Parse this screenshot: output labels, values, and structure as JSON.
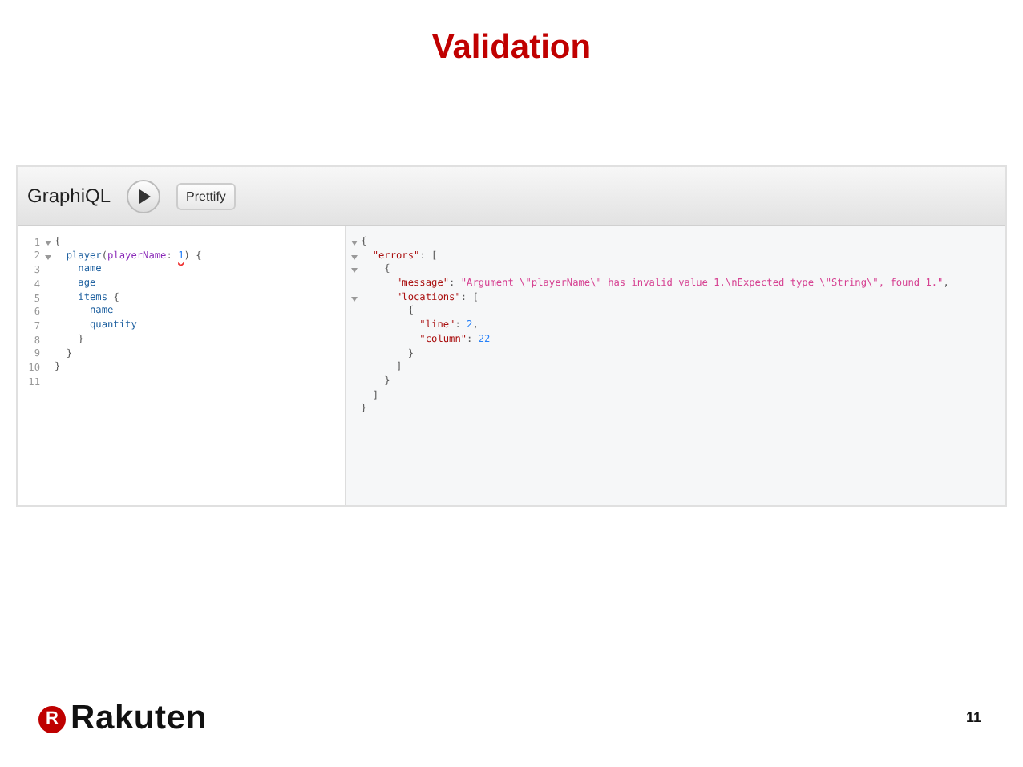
{
  "slide_title": "Validation",
  "graphiql": {
    "logo": "GraphiQL",
    "prettify_label": "Prettify",
    "query_lines": [
      {
        "number": "1",
        "fold": true,
        "tokens": [
          {
            "kind": "punct",
            "text": "{"
          }
        ]
      },
      {
        "number": "2",
        "fold": true,
        "tokens": [
          {
            "kind": "field",
            "text": "  player"
          },
          {
            "kind": "punct",
            "text": "("
          },
          {
            "kind": "arg",
            "text": "playerName"
          },
          {
            "kind": "punct",
            "text": ": "
          },
          {
            "kind": "number",
            "text": "1",
            "error": true
          },
          {
            "kind": "punct",
            "text": ") {"
          }
        ]
      },
      {
        "number": "3",
        "fold": false,
        "tokens": [
          {
            "kind": "field",
            "text": "    name"
          }
        ]
      },
      {
        "number": "4",
        "fold": false,
        "tokens": [
          {
            "kind": "field",
            "text": "    age"
          }
        ]
      },
      {
        "number": "5",
        "fold": false,
        "tokens": [
          {
            "kind": "field",
            "text": "    items"
          },
          {
            "kind": "punct",
            "text": " {"
          }
        ]
      },
      {
        "number": "6",
        "fold": false,
        "tokens": [
          {
            "kind": "field",
            "text": "      name"
          }
        ]
      },
      {
        "number": "7",
        "fold": false,
        "tokens": [
          {
            "kind": "field",
            "text": "      quantity"
          }
        ]
      },
      {
        "number": "8",
        "fold": false,
        "tokens": [
          {
            "kind": "punct",
            "text": "    }"
          }
        ]
      },
      {
        "number": "9",
        "fold": false,
        "tokens": [
          {
            "kind": "punct",
            "text": "  }"
          }
        ]
      },
      {
        "number": "10",
        "fold": false,
        "tokens": [
          {
            "kind": "punct",
            "text": "}"
          }
        ]
      },
      {
        "number": "11",
        "fold": false
      }
    ],
    "result_lines": [
      {
        "fold": true,
        "tokens": [
          {
            "kind": "punct",
            "text": "{"
          }
        ]
      },
      {
        "fold": true,
        "tokens": [
          {
            "kind": "key",
            "text": "  \"errors\""
          },
          {
            "kind": "punct",
            "text": ": ["
          }
        ]
      },
      {
        "fold": true,
        "tokens": [
          {
            "kind": "punct",
            "text": "    {"
          }
        ]
      },
      {
        "fold": false,
        "tokens": [
          {
            "kind": "key",
            "text": "      \"message\""
          },
          {
            "kind": "punct",
            "text": ": "
          },
          {
            "kind": "string",
            "text": "\"Argument \\\"playerName\\\" has invalid value 1.\\nExpected type \\\"String\\\", found 1.\""
          },
          {
            "kind": "punct",
            "text": ","
          }
        ]
      },
      {
        "fold": true,
        "tokens": [
          {
            "kind": "key",
            "text": "      \"locations\""
          },
          {
            "kind": "punct",
            "text": ": ["
          }
        ]
      },
      {
        "fold": false,
        "tokens": [
          {
            "kind": "punct",
            "text": "        {"
          }
        ]
      },
      {
        "fold": false,
        "tokens": [
          {
            "kind": "key",
            "text": "          \"line\""
          },
          {
            "kind": "punct",
            "text": ": "
          },
          {
            "kind": "number",
            "text": "2"
          },
          {
            "kind": "punct",
            "text": ","
          }
        ]
      },
      {
        "fold": false,
        "tokens": [
          {
            "kind": "key",
            "text": "          \"column\""
          },
          {
            "kind": "punct",
            "text": ": "
          },
          {
            "kind": "number",
            "text": "22"
          }
        ]
      },
      {
        "fold": false,
        "tokens": [
          {
            "kind": "punct",
            "text": "        }"
          }
        ]
      },
      {
        "fold": false,
        "tokens": [
          {
            "kind": "punct",
            "text": "      ]"
          }
        ]
      },
      {
        "fold": false,
        "tokens": [
          {
            "kind": "punct",
            "text": "    }"
          }
        ]
      },
      {
        "fold": false,
        "tokens": [
          {
            "kind": "punct",
            "text": "  ]"
          }
        ]
      },
      {
        "fold": false,
        "tokens": [
          {
            "kind": "punct",
            "text": "}"
          }
        ]
      }
    ]
  },
  "footer": {
    "brand": "Rakuten",
    "brand_mark": "R",
    "page_number": "11"
  }
}
